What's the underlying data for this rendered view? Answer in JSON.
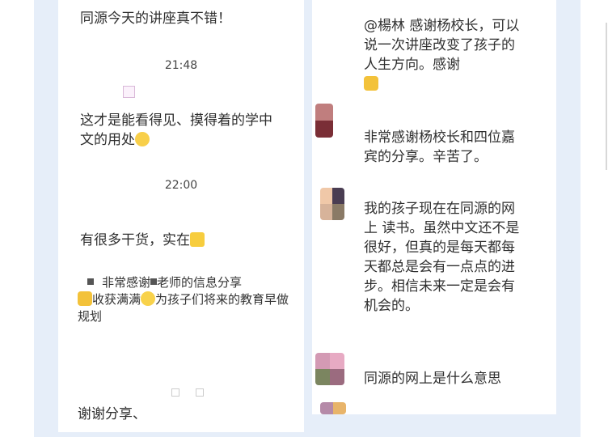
{
  "left": {
    "msg1": "同源今天的讲座真不错！",
    "time1": "21:48",
    "msg2": "这才是能看得见、摸得着的学中文的用处",
    "time2": "22:00",
    "msg3": "有很多干货，实在",
    "msg4a": "非常感谢",
    "msg4b": "老师的信息分享",
    "msg4c": "收获满满",
    "msg4d": "为孩子们将来的教育早做规划",
    "msg5": "谢谢分享、"
  },
  "right": {
    "msg1": "@楊林 感谢杨校长，可以说一次讲座改变了孩子的人生方向。感谢",
    "msg2": "非常感谢杨校长和四位嘉宾的分享。辛苦了。",
    "msg3": "我的孩子现在在同源的网上 读书。虽然中文还不是很好，但真的是每天都每天都总是会有一点点的进步。相信未来一定是会有机会的。",
    "msg4": "同源的网上是什么意思"
  },
  "icons": [
    "pray-emoji-icon",
    "wink-emoji-icon",
    "thumbs-up-emoji-icon",
    "smile-emoji-icon"
  ]
}
